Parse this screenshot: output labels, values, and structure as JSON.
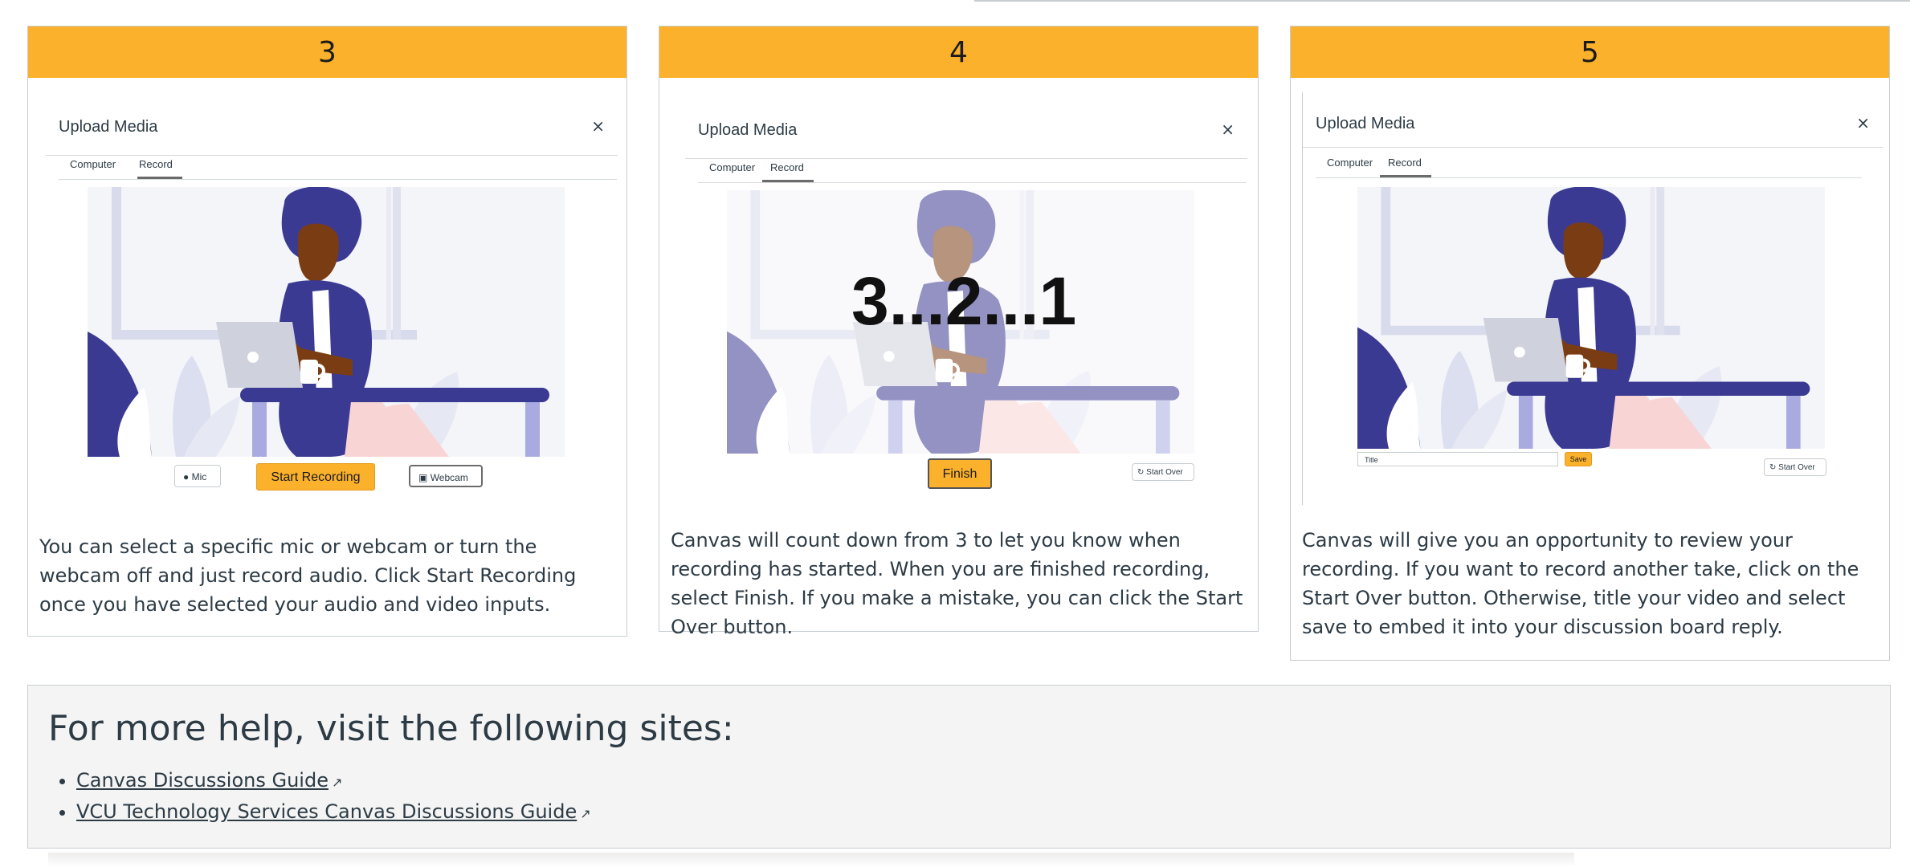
{
  "steps": [
    {
      "number": "3",
      "modal_title": "Upload Media",
      "close": "×",
      "tab_computer": "Computer",
      "tab_record": "Record",
      "mic_label": "Mic",
      "start_label": "Start Recording",
      "webcam_label": "Webcam",
      "description": "You can select a specific mic or webcam or turn the webcam off and just record audio. Click Start Recording once you have selected your audio and video inputs."
    },
    {
      "number": "4",
      "modal_title": "Upload Media",
      "close": "×",
      "tab_computer": "Computer",
      "tab_record": "Record",
      "countdown": "3...2...1",
      "finish_label": "Finish",
      "start_over_label": "Start Over",
      "description": "Canvas will count down from 3 to let you know when recording has started. When you are finished recording, select Finish. If you make a mistake, you can click the Start Over button."
    },
    {
      "number": "5",
      "modal_title": "Upload Media",
      "close": "×",
      "tab_computer": "Computer",
      "tab_record": "Record",
      "title_placeholder": "Title",
      "save_label": "Save",
      "start_over_label": "Start Over",
      "description": "Canvas will give you an opportunity to review your recording. If you want to record another take, click on the Start Over button. Otherwise, title your video and select save to embed it into your discussion board reply."
    }
  ],
  "help": {
    "heading": "For more help, visit the following sites:",
    "links": [
      "Canvas Discussions Guide",
      "VCU Technology Services Canvas Discussions Guide"
    ]
  },
  "colors": {
    "accent": "#fbb12b",
    "illustration_primary": "#3b3a93",
    "skin": "#7a3c13"
  },
  "icons": [
    "mic-icon",
    "webcam-icon",
    "start-over-icon",
    "external-link-icon",
    "close-icon"
  ]
}
